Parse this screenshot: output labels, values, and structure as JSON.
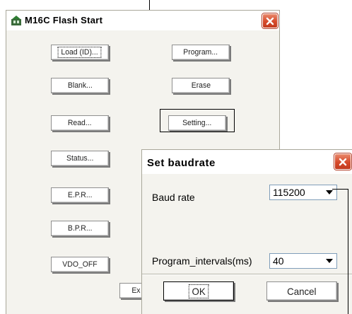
{
  "main_window": {
    "title": "M16C Flash Start",
    "icons": {
      "app": "app-icon",
      "close": "close-icon"
    },
    "buttons": {
      "load": "Load (ID)...",
      "program": "Program...",
      "blank": "Blank...",
      "erase": "Erase",
      "read": "Read...",
      "setting": "Setting...",
      "status": "Status...",
      "epr": "E.P.R...",
      "bpr": "B.P.R...",
      "vdo": "VDO_OFF",
      "exit": "Ex"
    }
  },
  "dialog": {
    "title": "Set baudrate",
    "baud_rate": {
      "label": "Baud rate",
      "value": "115200"
    },
    "program_intervals": {
      "label": "Program_intervals(ms)",
      "value": "40"
    },
    "ok": "OK",
    "cancel": "Cancel"
  },
  "colors": {
    "close_red": "#d6492a",
    "window_bg": "#f4f3ee",
    "combo_border": "#7f9db9"
  }
}
